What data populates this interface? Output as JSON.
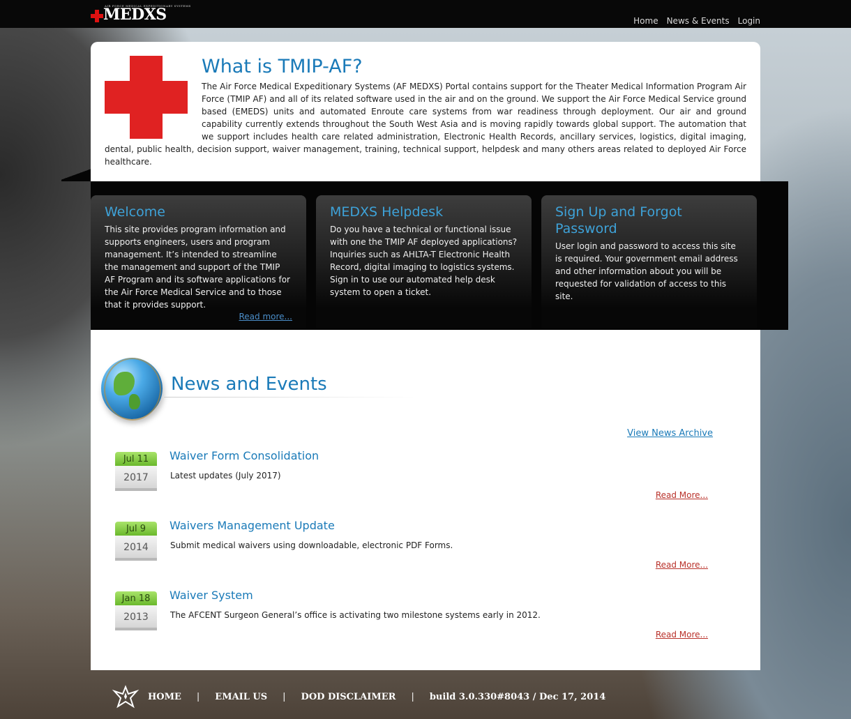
{
  "header": {
    "logo_text": "MEDXS",
    "logo_tagline": "AIR FORCE MEDICAL EXPEDITIONARY SYSTEMS",
    "nav": [
      "Home",
      "News & Events",
      "Login"
    ]
  },
  "intro": {
    "title": "What is TMIP-AF?",
    "body": "The Air Force Medical Expeditionary Systems (AF MEDXS) Portal contains support for the Theater Medical Information Program Air Force (TMIP AF) and all of its related software used in the air and on the ground. We support the Air Force Medical Service ground based (EMEDS) units and automated Enroute care systems from war readiness through deployment. Our air and ground capability currently extends throughout the South West Asia and is moving rapidly towards global support. The automation that we support includes health care related administration, Electronic Health Records, ancillary services, logistics, digital imaging, dental, public health, decision support, waiver management, training, technical support, helpdesk and many others areas related to deployed Air Force healthcare."
  },
  "cards": [
    {
      "title": "Welcome",
      "body": "This site provides program information and supports engineers, users and program management. It’s intended to streamline the management and support of the TMIP AF Program and its software applications for the Air Force Medical Service and to those that it provides support.",
      "link": "Read more..."
    },
    {
      "title": "MEDXS Helpdesk",
      "body": "Do you have a technical or functional issue with one the TMIP AF deployed applications? Inquiries such as AHLTA-T Electronic Health Record, digital imaging to logistics systems. Sign in to use our automated help desk system to open a ticket."
    },
    {
      "title": "Sign Up and Forgot Password",
      "body": "User login and password to access this site is required. Your government email address and other information about you will be requested for validation of access to this site."
    }
  ],
  "news": {
    "title": "News and Events",
    "archive_link": "View News Archive",
    "items": [
      {
        "month_day": "Jul 11",
        "year": "2017",
        "title": "Waiver Form Consolidation",
        "summary": "Latest updates (July 2017)",
        "more": "Read More..."
      },
      {
        "month_day": "Jul 9",
        "year": "2014",
        "title": "Waivers Management Update",
        "summary": "Submit medical waivers using downloadable, electronic PDF Forms.",
        "more": "Read More..."
      },
      {
        "month_day": "Jan 18",
        "year": "2013",
        "title": "Waiver System",
        "summary": "The AFCENT Surgeon General’s office is activating two milestone systems early in 2012.",
        "more": "Read More..."
      }
    ]
  },
  "footer": {
    "links": [
      "HOME",
      "EMAIL US",
      "DOD DISCLAIMER"
    ],
    "separator": "|",
    "build": "build 3.0.330#8043 / Dec 17, 2014"
  }
}
